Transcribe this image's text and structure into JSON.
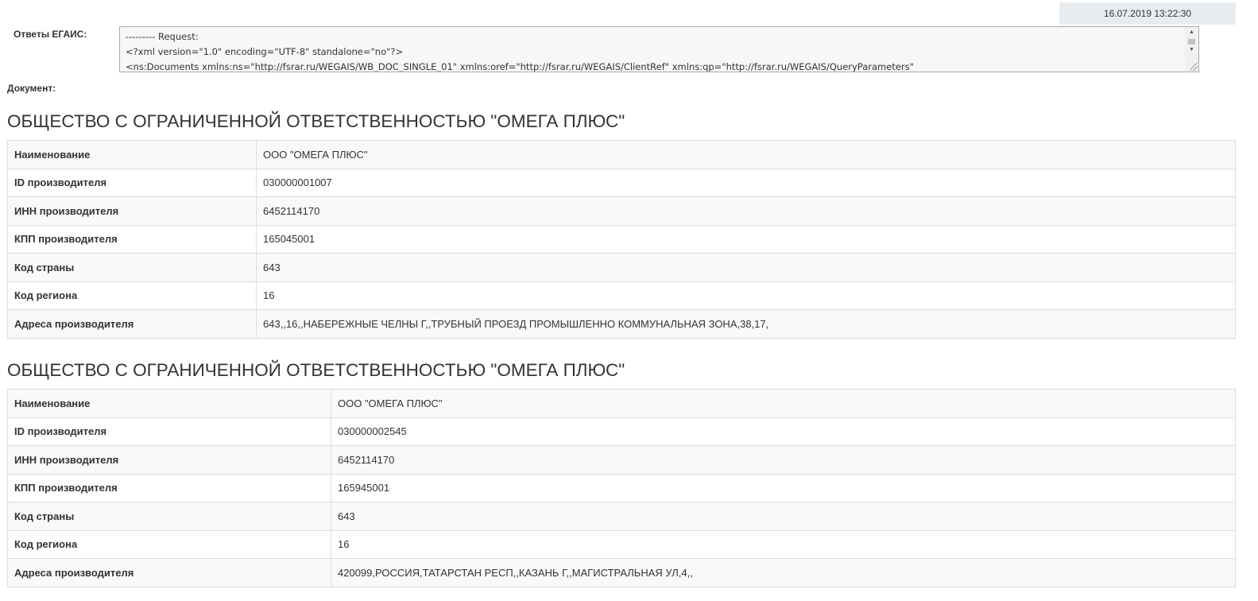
{
  "timestamp": "16.07.2019 13:22:30",
  "answers_label": "Ответы ЕГАИС:",
  "xml_lines": [
    "--------- Request:",
    "<?xml version=\"1.0\" encoding=\"UTF-8\" standalone=\"no\"?>",
    "<ns:Documents xmlns:ns=\"http://fsrar.ru/WEGAIS/WB_DOC_SINGLE_01\" xmlns:oref=\"http://fsrar.ru/WEGAIS/ClientRef\" xmlns:qp=\"http://fsrar.ru/WEGAIS/QueryParameters\""
  ],
  "document_label": "Документ:",
  "sections": [
    {
      "title": "ОБЩЕСТВО С ОГРАНИЧЕННОЙ ОТВЕТСТВЕННОСТЬЮ \"ОМЕГА ПЛЮС\"",
      "rows": [
        {
          "key": "Наименование",
          "value": "ООО \"ОМЕГА ПЛЮС\""
        },
        {
          "key": "ID производителя",
          "value": "030000001007"
        },
        {
          "key": "ИНН производителя",
          "value": "6452114170"
        },
        {
          "key": "КПП производителя",
          "value": "165045001"
        },
        {
          "key": "Код страны",
          "value": "643"
        },
        {
          "key": "Код региона",
          "value": "16"
        },
        {
          "key": "Адреса производителя",
          "value": "643,,16,,НАБЕРЕЖНЫЕ ЧЕЛНЫ Г,,ТРУБНЫЙ ПРОЕЗД ПРОМЫШЛЕННО КОММУНАЛЬНАЯ ЗОНА,38,17,"
        }
      ]
    },
    {
      "title": "ОБЩЕСТВО С ОГРАНИЧЕННОЙ ОТВЕТСТВЕННОСТЬЮ \"ОМЕГА ПЛЮС\"",
      "rows": [
        {
          "key": "Наименование",
          "value": "ООО \"ОМЕГА ПЛЮС\""
        },
        {
          "key": "ID производителя",
          "value": "030000002545"
        },
        {
          "key": "ИНН производителя",
          "value": "6452114170"
        },
        {
          "key": "КПП производителя",
          "value": "165945001"
        },
        {
          "key": "Код страны",
          "value": "643"
        },
        {
          "key": "Код региона",
          "value": "16"
        },
        {
          "key": "Адреса производителя",
          "value": "420099,РОССИЯ,ТАТАРСТАН РЕСП,,КАЗАНЬ Г,,МАГИСТРАЛЬНАЯ УЛ,4,,"
        }
      ]
    }
  ],
  "icons": {
    "scroll_up": "triangle-up",
    "scroll_down": "triangle-down",
    "resize": "resize-grip"
  }
}
